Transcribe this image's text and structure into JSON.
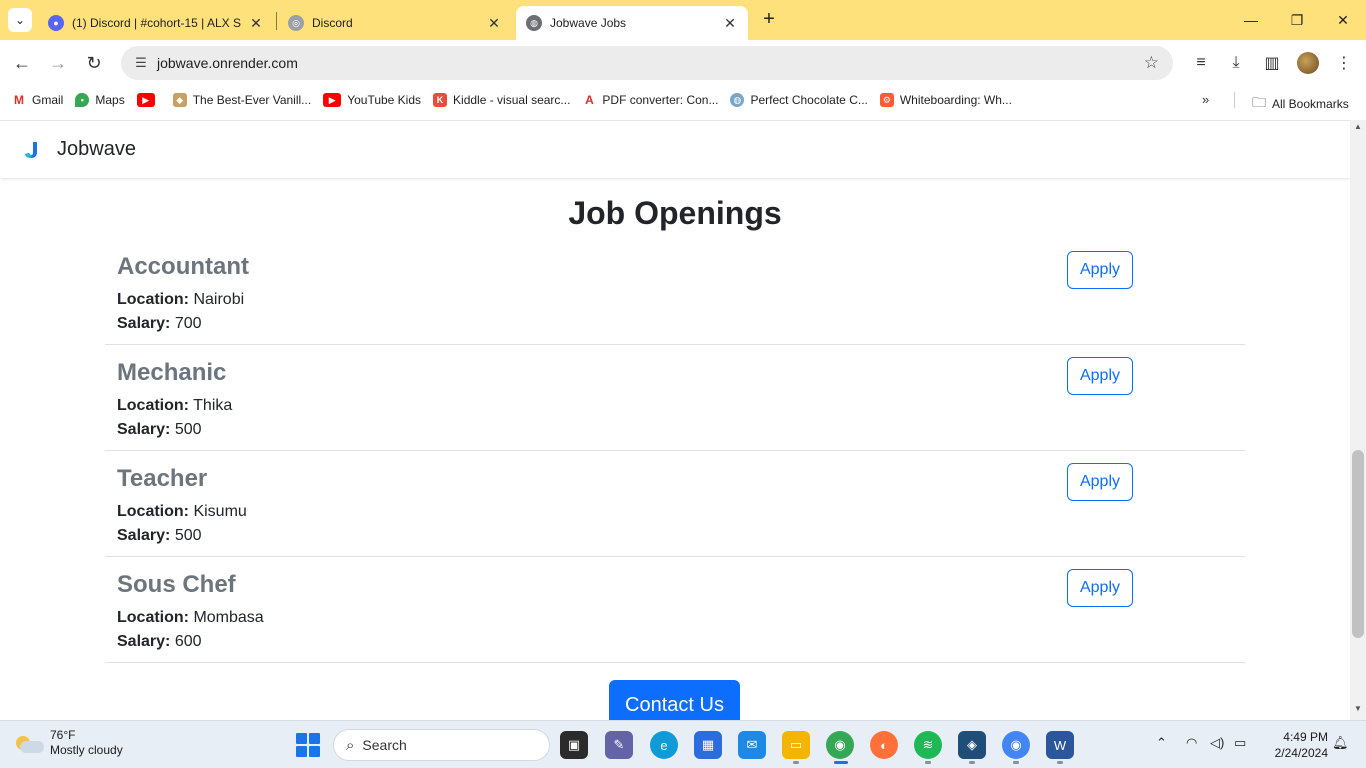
{
  "browser": {
    "tabs": [
      {
        "title": "(1) Discord | #cohort-15 | ALX S",
        "active": false
      },
      {
        "title": "Discord",
        "active": false
      },
      {
        "title": "Jobwave Jobs",
        "active": true
      }
    ],
    "url": "jobwave.onrender.com",
    "bookmarks": [
      {
        "label": "Gmail"
      },
      {
        "label": "Maps"
      },
      {
        "label": ""
      },
      {
        "label": "The Best-Ever Vanill..."
      },
      {
        "label": "YouTube Kids"
      },
      {
        "label": "Kiddle - visual searc..."
      },
      {
        "label": "PDF converter: Con..."
      },
      {
        "label": "Perfect Chocolate C..."
      },
      {
        "label": "Whiteboarding: Wh..."
      }
    ],
    "all_bookmarks": "All Bookmarks"
  },
  "page": {
    "brand": "Jobwave",
    "heading": "Job Openings",
    "location_label": "Location:",
    "salary_label": "Salary:",
    "apply_label": "Apply",
    "jobs": [
      {
        "title": "Accountant",
        "location": "Nairobi",
        "salary": "700"
      },
      {
        "title": "Mechanic",
        "location": "Thika",
        "salary": "500"
      },
      {
        "title": "Teacher",
        "location": "Kisumu",
        "salary": "500"
      },
      {
        "title": "Sous Chef",
        "location": "Mombasa",
        "salary": "600"
      }
    ],
    "contact_label": "Contact Us",
    "accent_color": "#0d6efd"
  },
  "taskbar": {
    "weather_temp": "76°F",
    "weather_desc": "Mostly cloudy",
    "search_label": "Search",
    "time": "4:49 PM",
    "date": "2/24/2024"
  }
}
